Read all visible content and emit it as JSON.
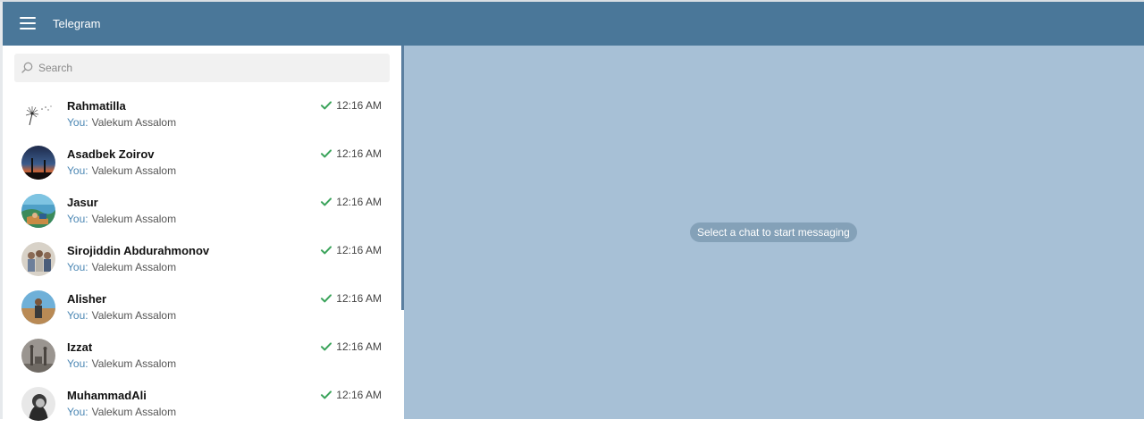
{
  "app": {
    "title": "Telegram"
  },
  "search": {
    "placeholder": "Search"
  },
  "chats": [
    {
      "name": "Rahmatilla",
      "sender": "You:",
      "message": "Valekum Assalom",
      "time": "12:16 AM"
    },
    {
      "name": "Asadbek Zoirov",
      "sender": "You:",
      "message": "Valekum Assalom",
      "time": "12:16 AM"
    },
    {
      "name": "Jasur",
      "sender": "You:",
      "message": "Valekum Assalom",
      "time": "12:16 AM"
    },
    {
      "name": "Sirojiddin Abdurahmonov",
      "sender": "You:",
      "message": "Valekum Assalom",
      "time": "12:16 AM"
    },
    {
      "name": "Alisher",
      "sender": "You:",
      "message": "Valekum Assalom",
      "time": "12:16 AM"
    },
    {
      "name": "Izzat",
      "sender": "You:",
      "message": "Valekum Assalom",
      "time": "12:16 AM"
    },
    {
      "name": "MuhammadAli",
      "sender": "You:",
      "message": "Valekum Assalom",
      "time": "12:16 AM"
    }
  ],
  "main": {
    "empty_text": "Select a chat to start messaging"
  },
  "colors": {
    "header": "#4a7799",
    "chat_background": "#a7c0d6",
    "read_check": "#3aa35a",
    "sender_label": "#4a86b3"
  },
  "icons": {
    "menu": "hamburger-icon",
    "search": "search-icon",
    "status": "check-icon"
  }
}
